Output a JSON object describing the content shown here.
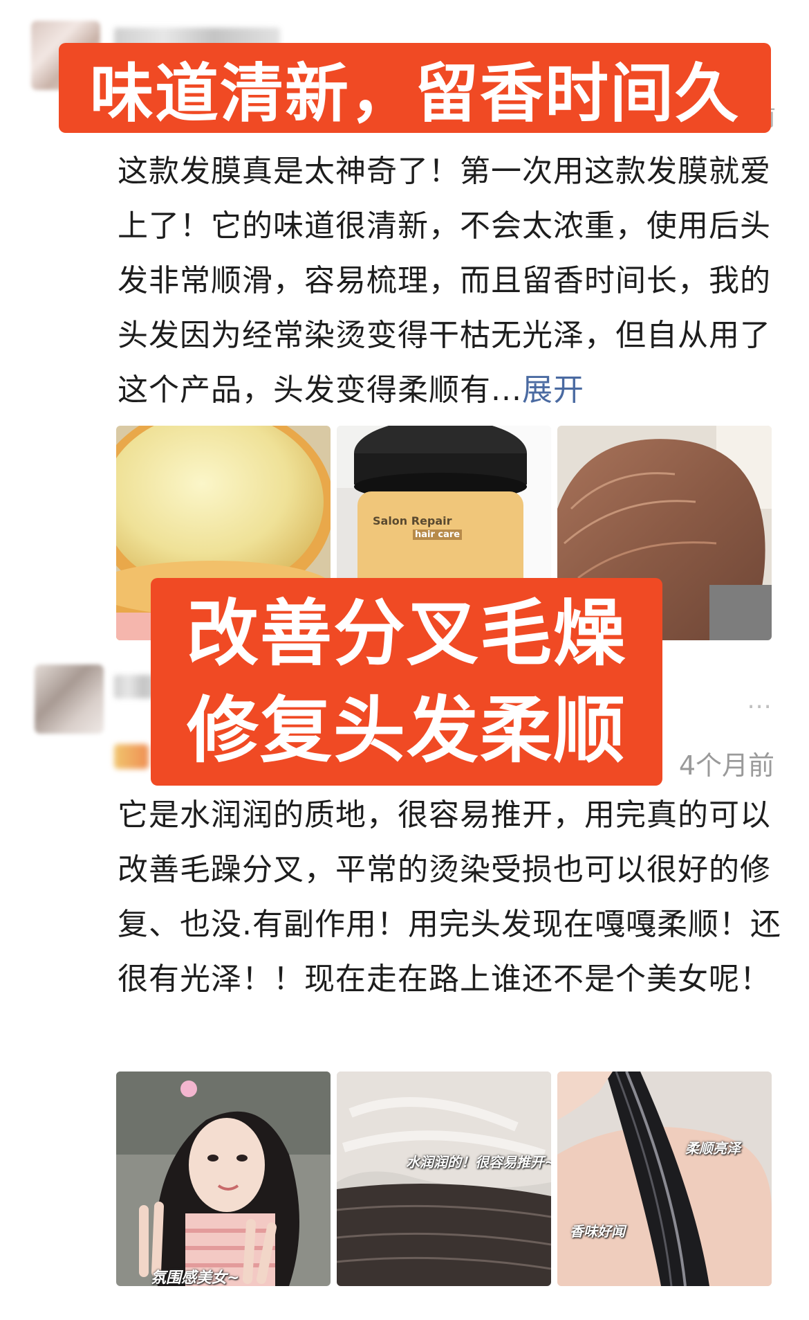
{
  "colors": {
    "banner": "#f04a24",
    "expand_link": "#4a6aa1",
    "timestamp": "#9a9a9a"
  },
  "banners": {
    "top": "味道清新，留香时间久",
    "middle_line1": "改善分叉毛燥",
    "middle_line2": "修复头发柔顺"
  },
  "comment1": {
    "time_partial": "前",
    "text": "这款发膜真是太神奇了！第一次用这款发膜就爱上了！它的味道很清新，不会太浓重，使用后头发非常顺滑，容易梳理，而且留香时间长，我的头发因为经常染烫变得干枯无光泽，但自从用了这个产品，头发变得柔顺有...",
    "expand_label": "展开",
    "images": [
      {
        "desc_icon": "hair-mask-jar-open-image"
      },
      {
        "desc_icon": "hair-mask-jar-product-image",
        "label": "Salon Repair",
        "sub_label": "hair care"
      },
      {
        "desc_icon": "hair-top-view-image"
      }
    ]
  },
  "comment2": {
    "more_icon": "⋯",
    "time": "4个月前",
    "text": "它是水润润的质地，很容易推开，用完真的可以改善毛躁分叉，平常的烫染受损也可以很好的修复、也没.有副作用！用完头发现在嘎嘎柔顺！还很有光泽！！现在走在路上谁还不是个美女呢！",
    "images": [
      {
        "desc_icon": "girl-peace-sign-image",
        "caption": "氛围感美女~"
      },
      {
        "desc_icon": "hair-mask-applying-image",
        "caption": "水润润的！很容易推开~"
      },
      {
        "desc_icon": "shiny-hair-in-hand-image",
        "caption1": "柔顺亮泽",
        "caption2": "香味好闻"
      }
    ]
  }
}
